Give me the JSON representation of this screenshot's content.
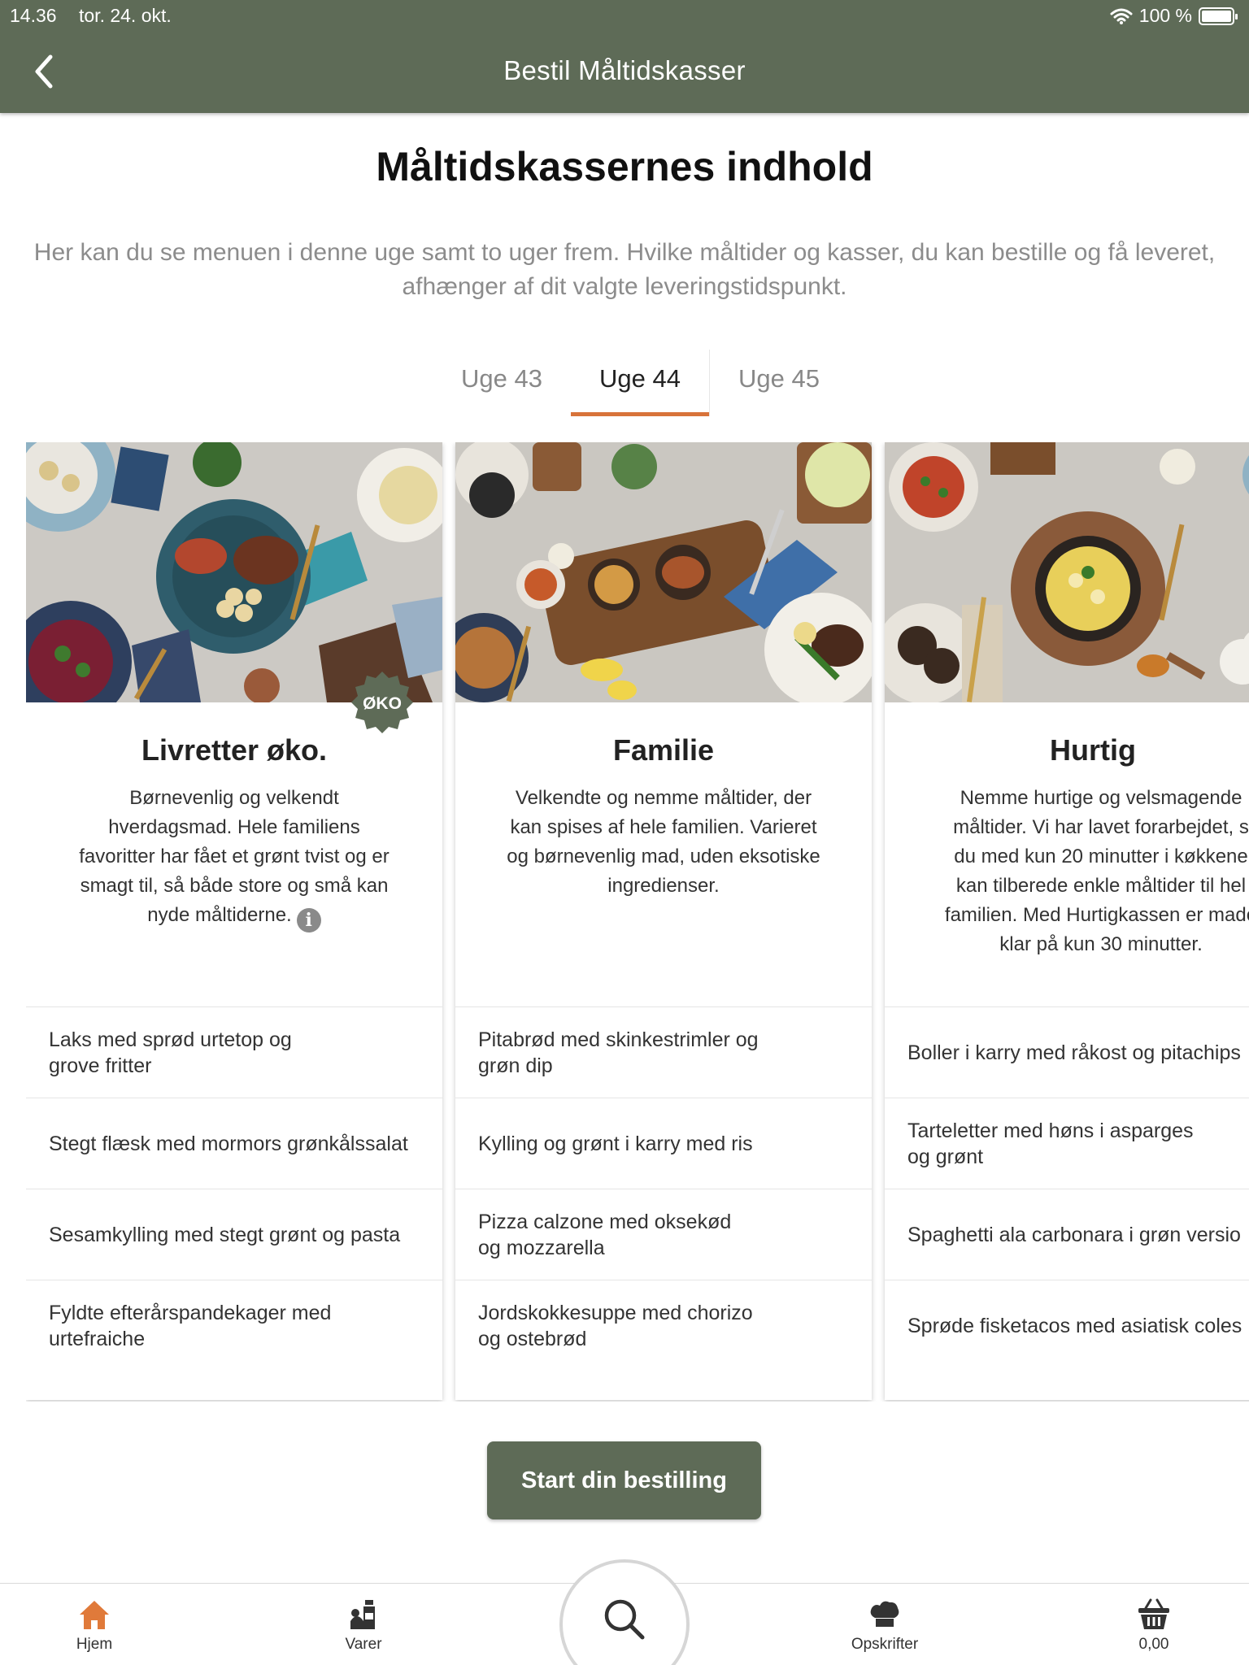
{
  "status_bar": {
    "time": "14.36",
    "date": "tor. 24. okt.",
    "battery": "100 %"
  },
  "nav": {
    "title": "Bestil Måltidskasser"
  },
  "page": {
    "title": "Måltidskassernes indhold",
    "intro": "Her kan du se menuen i denne uge samt to uger frem. Hvilke måltider og kasser, du kan bestille og få leveret, afhænger af dit valgte leveringstidspunkt."
  },
  "tabs": [
    {
      "label": "Uge 43",
      "active": false
    },
    {
      "label": "Uge 44",
      "active": true
    },
    {
      "label": "Uge 45",
      "active": false
    }
  ],
  "cards": [
    {
      "name": "Livretter øko.",
      "badge": "ØKO",
      "description": "Børnevenlig og velkendt\nhverdagsmad. Hele familiens\nfavoritter har fået et grønt tvist og er\nsmagt til, så både store og små kan\nnyde måltiderne.",
      "items": [
        "Laks med sprød urtetop og\ngrove fritter",
        "Stegt flæsk med mormors grønkålssalat",
        "Sesamkylling med stegt grønt og pasta",
        "Fyldte efterårspandekager med\nurtefraiche"
      ]
    },
    {
      "name": "Familie",
      "description": "Velkendte og nemme måltider, der\nkan spises af hele familien.  Varieret\nog børnevenlig mad, uden eksotiske\ningredienser.",
      "items": [
        "Pitabrød med skinkestrimler og\ngrøn dip",
        "Kylling og grønt i karry med ris",
        "Pizza calzone med oksekød\nog mozzarella",
        "Jordskokkesuppe med chorizo\nog ostebrød"
      ]
    },
    {
      "name": "Hurtig",
      "description": "Nemme hurtige og velsmagende\nmåltider. Vi har lavet forarbejdet, s\ndu med kun 20 minutter i køkkene\nkan tilberede enkle måltider til hel\nfamilien. Med Hurtigkassen er made\nklar på kun 30 minutter.",
      "items": [
        "Boller i karry med råkost og pitachips",
        "Tarteletter med høns i asparges\nog grønt",
        "Spaghetti ala carbonara i grøn versio",
        "Sprøde fisketacos med asiatisk coles"
      ]
    }
  ],
  "cta": {
    "label": "Start din bestilling"
  },
  "tabbar": [
    {
      "label": "Hjem",
      "icon": "home-icon"
    },
    {
      "label": "Varer",
      "icon": "groceries-icon"
    },
    {
      "label": "",
      "icon": "search-icon"
    },
    {
      "label": "Opskrifter",
      "icon": "chef-hat-icon"
    },
    {
      "label": "0,00",
      "icon": "basket-icon"
    }
  ],
  "colors": {
    "brand_green": "#5e6b57",
    "accent_orange": "#d8733a",
    "home_active": "#e07a3a"
  }
}
